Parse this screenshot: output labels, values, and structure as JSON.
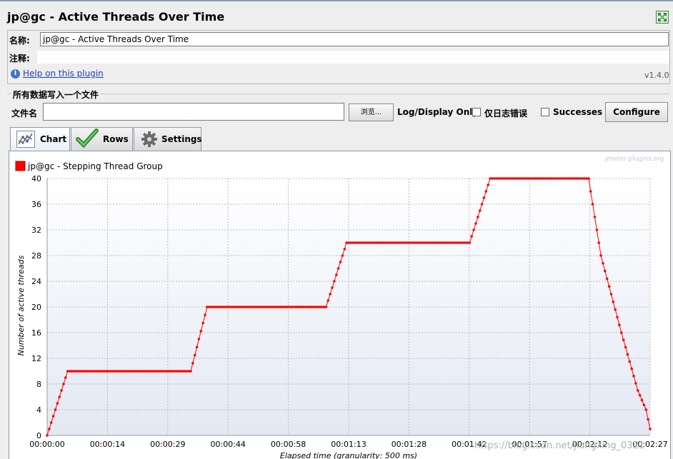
{
  "window": {
    "title": "jp@gc - Active Threads Over Time"
  },
  "form": {
    "name_label": "名称:",
    "name_value": "jp@gc - Active Threads Over Time",
    "comment_label": "注释:",
    "help_link": "Help on this plugin",
    "version": "v1.4.0"
  },
  "file_group": {
    "title": "所有数据写入一个文件",
    "filename_label": "文件名",
    "filename_value": "",
    "browse_label": "浏览...",
    "log_display_label": "Log/Display Only:",
    "errors_only_label": "仅日志错误",
    "successes_label": "Successes",
    "configure_label": "Configure"
  },
  "tabs": [
    {
      "label": "Chart",
      "icon": "line-chart-icon",
      "active": true
    },
    {
      "label": "Rows",
      "icon": "checkmark-icon",
      "active": false
    },
    {
      "label": "Settings",
      "icon": "gear-icon",
      "active": false
    }
  ],
  "watermark": "jmeter-plugins.org",
  "page_watermark": "https://blog.csdn.net/jiangxing_0321",
  "chart_data": {
    "type": "line",
    "legend": [
      "jp@gc - Stepping Thread Group"
    ],
    "legend_placement": "top-left",
    "xlabel": "Elapsed time (granularity: 500 ms)",
    "ylabel": "Number of active threads",
    "ylim": [
      0,
      40
    ],
    "xlim_seconds": [
      0,
      147
    ],
    "grid": true,
    "x_ticks": [
      "00:00:00",
      "00:00:14",
      "00:00:29",
      "00:00:44",
      "00:00:58",
      "00:01:13",
      "00:01:28",
      "00:01:42",
      "00:01:57",
      "00:02:12",
      "00:02:27"
    ],
    "y_ticks": [
      0,
      4,
      8,
      12,
      16,
      20,
      24,
      28,
      32,
      36,
      40
    ],
    "series": [
      {
        "name": "jp@gc - Stepping Thread Group",
        "color": "#ff0000",
        "x": [
          "00:00:00",
          "00:00:05",
          "00:00:35",
          "00:00:39",
          "00:01:08",
          "00:01:13",
          "00:01:43",
          "00:01:48",
          "00:02:12",
          "00:02:15",
          "00:02:20",
          "00:02:24",
          "00:02:26",
          "00:02:27"
        ],
        "y": [
          0,
          10,
          10,
          20,
          20,
          30,
          30,
          40,
          40,
          28,
          16,
          7,
          4,
          1
        ]
      }
    ]
  }
}
